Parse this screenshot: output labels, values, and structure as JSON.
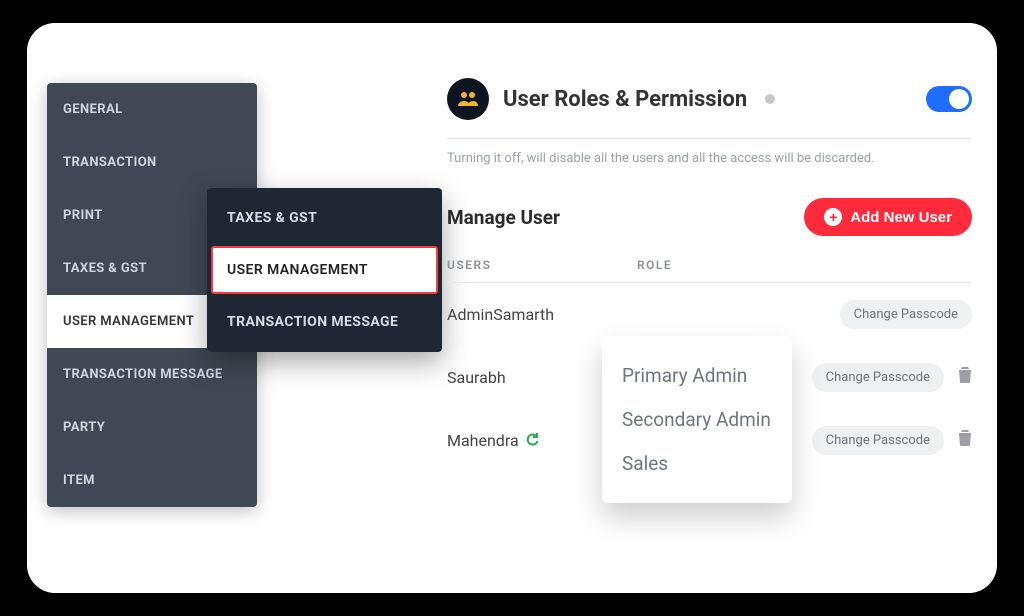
{
  "sidebar": {
    "items": [
      {
        "label": "GENERAL"
      },
      {
        "label": "TRANSACTION"
      },
      {
        "label": "PRINT"
      },
      {
        "label": "TAXES & GST"
      },
      {
        "label": "USER MANAGEMENT"
      },
      {
        "label": "TRANSACTION MESSAGE"
      },
      {
        "label": "PARTY"
      },
      {
        "label": "ITEM"
      }
    ],
    "active_index": 4
  },
  "overlay": {
    "items": [
      {
        "label": "TAXES & GST"
      },
      {
        "label": "USER MANAGEMENT"
      },
      {
        "label": "TRANSACTION MESSAGE"
      }
    ],
    "highlight_index": 1
  },
  "header": {
    "title": "User Roles & Permission",
    "subtext": "Turning it off, will disable all the users and all the access will be discarded.",
    "toggle_on": true
  },
  "manage": {
    "title": "Manage User",
    "add_label": "Add New User",
    "columns": {
      "users": "USERS",
      "role": "ROLE"
    },
    "rows": [
      {
        "user": "AdminSamarth",
        "role": "",
        "change_label": "Change Passcode",
        "show_trash": false,
        "show_sync": false
      },
      {
        "user": "Saurabh",
        "role": "",
        "change_label": "Change Passcode",
        "show_trash": true,
        "show_sync": false
      },
      {
        "user": "Mahendra",
        "role": "",
        "change_label": "Change Passcode",
        "show_trash": true,
        "show_sync": true
      }
    ]
  },
  "role_popover": {
    "items": [
      "Primary Admin",
      "Secondary Admin",
      "Sales"
    ]
  }
}
